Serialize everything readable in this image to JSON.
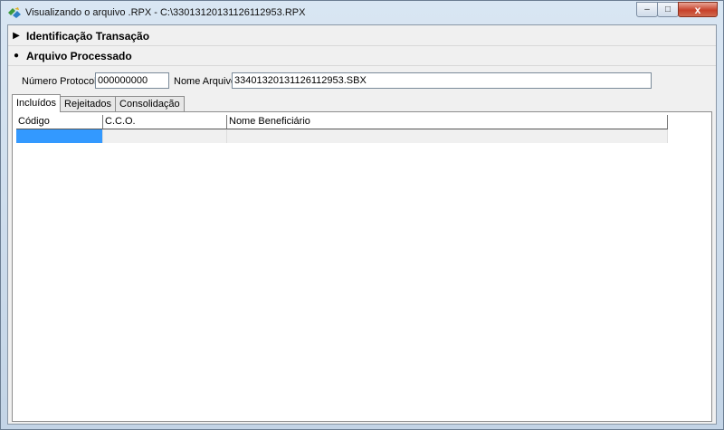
{
  "window": {
    "title": "Visualizando o arquivo .RPX - C:\\33013120131126112953.RPX",
    "controls": {
      "minimize": "–",
      "maximize": "□",
      "close": "x"
    }
  },
  "sections": [
    {
      "marker": "▶",
      "label": "Identificação Transação",
      "expanded": false
    },
    {
      "marker": "●",
      "label": "Arquivo Processado",
      "expanded": true
    }
  ],
  "form": {
    "protocol_label": "Número Protocolo",
    "protocol_value": "000000000",
    "file_label": "Nome Arquivo",
    "file_value": "33401320131126112953.SBX"
  },
  "tabs": [
    {
      "label": "Incluídos",
      "active": true
    },
    {
      "label": "Rejeitados",
      "active": false
    },
    {
      "label": "Consolidação",
      "active": false
    }
  ],
  "grid": {
    "columns": [
      "Código",
      "C.C.O.",
      "Nome Beneficiário"
    ],
    "rows": [
      [
        "",
        "",
        ""
      ]
    ]
  },
  "colors": {
    "selection": "#3399ff",
    "close_button": "#c7412a"
  }
}
